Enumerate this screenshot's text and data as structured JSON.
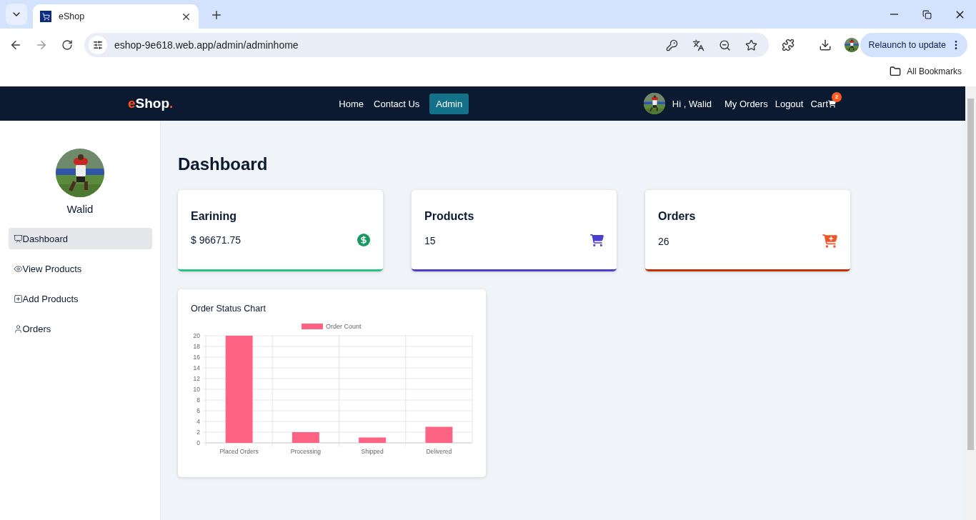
{
  "browser": {
    "tabs": [
      {
        "title": "eShop",
        "selected": true
      }
    ],
    "address": "eshop-9e618.web.app/admin/adminhome",
    "relaunch": "Relaunch to update",
    "bookmarks": [
      "All Bookmarks"
    ]
  },
  "navbar": {
    "logo": [
      {
        "text": "e",
        "color": "#ff4d1c"
      },
      {
        "text": "Shop",
        "color": "#ffffff"
      },
      {
        "text": ".",
        "color": "#ff4d1c"
      }
    ],
    "links": [
      {
        "label": "Home",
        "selected": false
      },
      {
        "label": "Contact Us",
        "selected": false
      },
      {
        "label": "Admin",
        "selected": true
      }
    ],
    "greeting": "Hi , Walid",
    "user_links": [
      "My Orders",
      "Logout"
    ],
    "cart": {
      "label": "Cart",
      "badge": "2"
    }
  },
  "sidebar": {
    "user_name": "Walid",
    "items": [
      {
        "label": "Dashboard",
        "selected": true
      },
      {
        "label": "View Products",
        "selected": false
      },
      {
        "label": "Add Products",
        "selected": false
      },
      {
        "label": "Orders",
        "selected": false
      }
    ]
  },
  "title": "Dashboard",
  "cards": [
    {
      "title": "Earining",
      "value": "$ 96671.75",
      "color": "#2fbf85"
    },
    {
      "title": "Products",
      "value": "15",
      "color": "#4a3fd0"
    },
    {
      "title": "Orders",
      "value": "26",
      "color": "#c1320a"
    }
  ],
  "chart": {
    "title": "Order Status Chart",
    "chart_data": {
      "type": "bar",
      "categories": [
        "Placed Orders",
        "Processing",
        "Shipped",
        "Delivered"
      ],
      "series": [
        {
          "name": "Order Count",
          "color": "#ff6384",
          "values": [
            20,
            2,
            1,
            3
          ]
        }
      ],
      "ylim": [
        0,
        20
      ],
      "grid": true,
      "yticks": [
        0,
        2,
        4,
        6,
        8,
        10,
        12,
        14,
        16,
        18,
        20
      ]
    }
  }
}
